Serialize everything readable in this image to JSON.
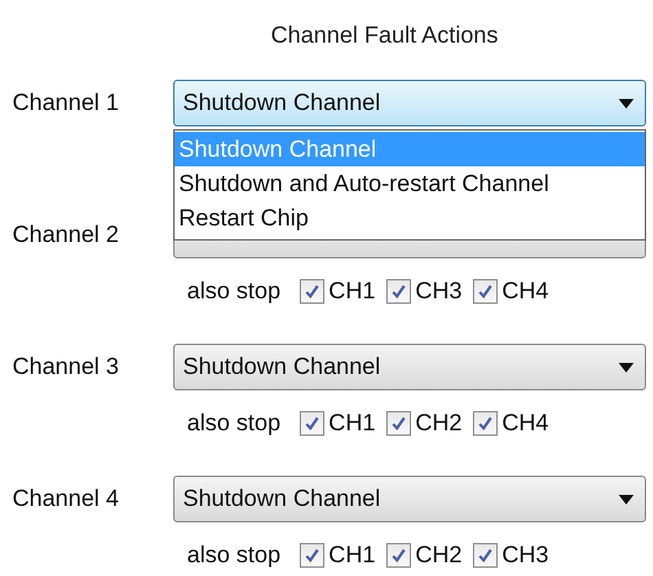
{
  "title": "Channel Fault Actions",
  "channels": [
    {
      "label": "Channel 1",
      "value": "Shutdown Channel",
      "open": true,
      "options": [
        {
          "label": "Shutdown Channel",
          "selected": true
        },
        {
          "label": "Shutdown and Auto-restart Channel",
          "selected": false
        },
        {
          "label": "Restart Chip",
          "selected": false
        }
      ]
    },
    {
      "label": "Channel 2",
      "open": false,
      "also_stop_label": "also stop",
      "also_stop": [
        {
          "label": "CH1",
          "checked": true
        },
        {
          "label": "CH3",
          "checked": true
        },
        {
          "label": "CH4",
          "checked": true
        }
      ]
    },
    {
      "label": "Channel 3",
      "value": "Shutdown Channel",
      "open": false,
      "also_stop_label": "also stop",
      "also_stop": [
        {
          "label": "CH1",
          "checked": true
        },
        {
          "label": "CH2",
          "checked": true
        },
        {
          "label": "CH4",
          "checked": true
        }
      ]
    },
    {
      "label": "Channel 4",
      "value": "Shutdown Channel",
      "open": false,
      "also_stop_label": "also stop",
      "also_stop": [
        {
          "label": "CH1",
          "checked": true
        },
        {
          "label": "CH2",
          "checked": true
        },
        {
          "label": "CH3",
          "checked": true
        }
      ]
    }
  ]
}
